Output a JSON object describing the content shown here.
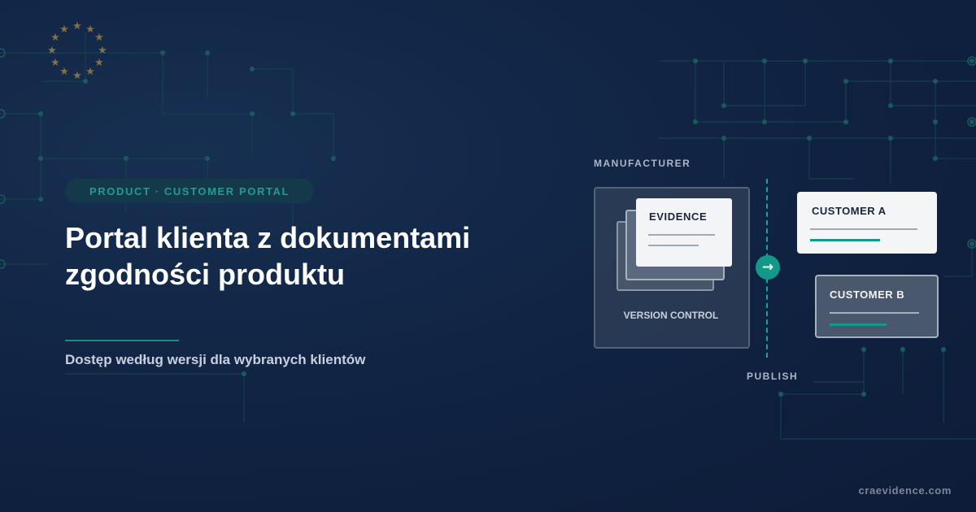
{
  "badge": "PRODUCT · CUSTOMER PORTAL",
  "headline": "Portal klienta z dokumentami zgodności produktu",
  "subtitle": "Dostęp według wersji dla wybranych klientów",
  "diagram": {
    "manufacturer_label": "MANUFACTURER",
    "evidence_label": "EVIDENCE",
    "version_control_label": "VERSION CONTROL",
    "publish_label": "PUBLISH",
    "customer_a_label": "CUSTOMER A",
    "customer_b_label": "CUSTOMER B"
  },
  "brand": "craevidence.com",
  "icons": {
    "eu_stars": "eu-stars-icon",
    "publish_arrow": "arrow-right-icon"
  },
  "colors": {
    "background": "#112444",
    "accent": "#13998a",
    "eu_star": "#857147"
  }
}
